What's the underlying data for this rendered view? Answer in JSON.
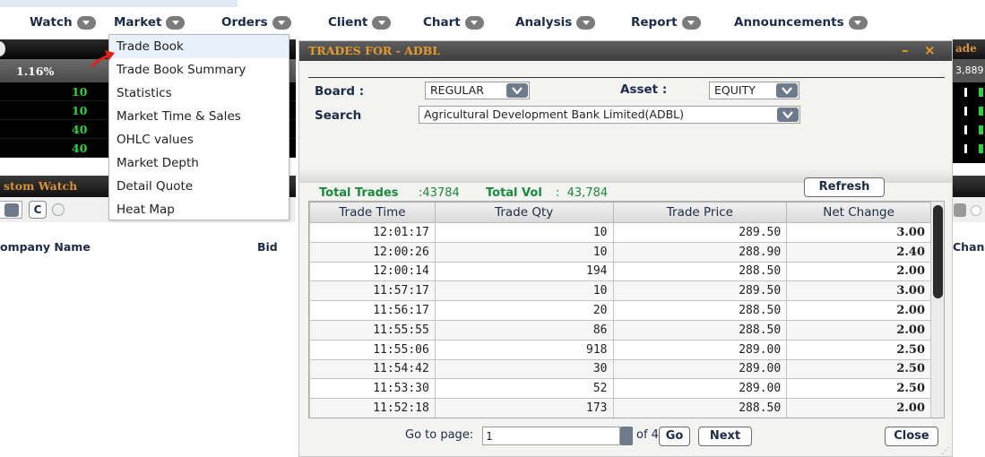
{
  "menu": [
    {
      "label": "Watch"
    },
    {
      "label": "Market"
    },
    {
      "label": "Orders"
    },
    {
      "label": "Client"
    },
    {
      "label": "Chart"
    },
    {
      "label": "Analysis"
    },
    {
      "label": "Report"
    },
    {
      "label": "Announcements"
    }
  ],
  "market_dropdown": {
    "items": [
      {
        "label": "Trade Book"
      },
      {
        "label": "Trade Book Summary"
      },
      {
        "label": "Statistics"
      },
      {
        "label": "Market Time & Sales"
      },
      {
        "label": "OHLC values"
      },
      {
        "label": "Market Depth"
      },
      {
        "label": "Detail Quote"
      },
      {
        "label": "Heat Map"
      }
    ]
  },
  "background": {
    "percent": "1.16%",
    "rows": [
      "10",
      "10",
      "40",
      "40"
    ],
    "custom_watch_title": "stom Watch",
    "c_button": "C",
    "company_header": "ompany Name",
    "bid_header": "Bid",
    "right_title": "ade",
    "right_value": "3,889",
    "right_change_header": "Chan"
  },
  "trade_window": {
    "title": "TRADES FOR - ADBL",
    "board_label": "Board :",
    "board_value": "REGULAR",
    "asset_label": "Asset :",
    "asset_value": "EQUITY",
    "search_label": "Search",
    "search_value": "Agricultural Development Bank Limited(ADBL)",
    "total_trades_label": "Total Trades",
    "total_trades_value": ":43784",
    "total_vol_label": "Total Vol",
    "total_vol_value": ":  43,784",
    "refresh_label": "Refresh",
    "columns": [
      "Trade Time",
      "Trade Qty",
      "Trade Price",
      "Net Change"
    ],
    "rows": [
      [
        "12:01:17",
        "10",
        "289.50",
        "3.00"
      ],
      [
        "12:00:26",
        "10",
        "288.90",
        "2.40"
      ],
      [
        "12:00:14",
        "194",
        "288.50",
        "2.00"
      ],
      [
        "11:57:17",
        "10",
        "289.50",
        "3.00"
      ],
      [
        "11:56:17",
        "20",
        "288.50",
        "2.00"
      ],
      [
        "11:55:55",
        "86",
        "288.50",
        "2.00"
      ],
      [
        "11:55:06",
        "918",
        "289.00",
        "2.50"
      ],
      [
        "11:54:42",
        "30",
        "289.00",
        "2.50"
      ],
      [
        "11:53:30",
        "52",
        "289.00",
        "2.50"
      ],
      [
        "11:52:18",
        "173",
        "288.50",
        "2.00"
      ]
    ],
    "goto_label": "Go to page:",
    "page_value": "1",
    "of_pages": "of 4",
    "go_label": "Go",
    "next_label": "Next",
    "close_label": "Close"
  },
  "colors": {
    "title_text": "#e49a2c",
    "totals_green": "#1a8a3c",
    "menu_text": "#1b2b49",
    "ticker_green": "#28d43a"
  },
  "icons": {
    "menu_caret": "chevron-down-icon",
    "pointer": "red-arrow-icon",
    "minimize": "minimize-icon",
    "close": "close-icon"
  }
}
